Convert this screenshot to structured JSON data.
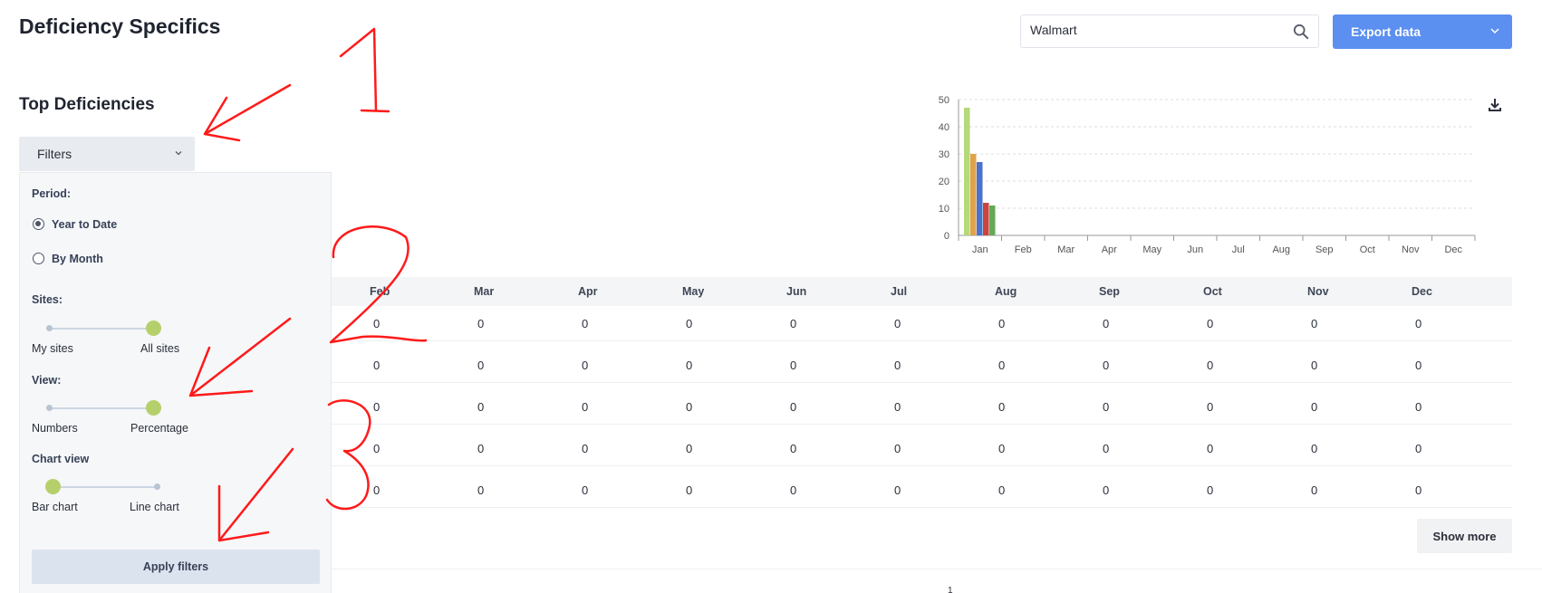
{
  "header": {
    "title": "Deficiency Specifics",
    "search_value": "Walmart",
    "export_label": "Export data"
  },
  "section": {
    "title": "Top Deficiencies",
    "filters_label": "Filters"
  },
  "filters": {
    "period_label": "Period:",
    "period_options": [
      "Year to Date",
      "By Month"
    ],
    "period_selected": "Year to Date",
    "sites_label": "Sites:",
    "sites_options": [
      "My sites",
      "All sites"
    ],
    "sites_selected": "All sites",
    "view_label": "View:",
    "view_options": [
      "Numbers",
      "Percentage"
    ],
    "view_selected": "Percentage",
    "chart_view_label": "Chart view",
    "chart_view_options": [
      "Bar chart",
      "Line chart"
    ],
    "chart_view_selected": "Bar chart",
    "apply_label": "Apply filters"
  },
  "chart_data": {
    "type": "bar",
    "categories": [
      "Jan",
      "Feb",
      "Mar",
      "Apr",
      "May",
      "Jun",
      "Jul",
      "Aug",
      "Sep",
      "Oct",
      "Nov",
      "Dec"
    ],
    "series": [
      {
        "color": "#b5d87a",
        "values": [
          47,
          0,
          0,
          0,
          0,
          0,
          0,
          0,
          0,
          0,
          0,
          0
        ]
      },
      {
        "color": "#e0a24a",
        "values": [
          30,
          0,
          0,
          0,
          0,
          0,
          0,
          0,
          0,
          0,
          0,
          0
        ]
      },
      {
        "color": "#4a72d0",
        "values": [
          27,
          0,
          0,
          0,
          0,
          0,
          0,
          0,
          0,
          0,
          0,
          0
        ]
      },
      {
        "color": "#c8453c",
        "values": [
          12,
          0,
          0,
          0,
          0,
          0,
          0,
          0,
          0,
          0,
          0,
          0
        ]
      },
      {
        "color": "#64a858",
        "values": [
          11,
          0,
          0,
          0,
          0,
          0,
          0,
          0,
          0,
          0,
          0,
          0
        ]
      }
    ],
    "yticks": [
      0,
      10,
      20,
      30,
      40,
      50
    ],
    "ylim": [
      0,
      50
    ],
    "grid": true,
    "title": "",
    "xlabel": "",
    "ylabel": ""
  },
  "table": {
    "columns": [
      "Feb",
      "Mar",
      "Apr",
      "May",
      "Jun",
      "Jul",
      "Aug",
      "Sep",
      "Oct",
      "Nov",
      "Dec"
    ],
    "rows": [
      [
        "0",
        "0",
        "0",
        "0",
        "0",
        "0",
        "0",
        "0",
        "0",
        "0",
        "0"
      ],
      [
        "0",
        "0",
        "0",
        "0",
        "0",
        "0",
        "0",
        "0",
        "0",
        "0",
        "0"
      ],
      [
        "0",
        "0",
        "0",
        "0",
        "0",
        "0",
        "0",
        "0",
        "0",
        "0",
        "0"
      ],
      [
        "0",
        "0",
        "0",
        "0",
        "0",
        "0",
        "0",
        "0",
        "0",
        "0",
        "0"
      ],
      [
        "0",
        "0",
        "0",
        "0",
        "0",
        "0",
        "0",
        "0",
        "0",
        "0",
        "0"
      ]
    ],
    "show_more_label": "Show more"
  },
  "footer": {
    "page_number": "1"
  },
  "annotations": {
    "marks": [
      "1",
      "2",
      "3"
    ],
    "color": "#ff1a1a"
  },
  "colors": {
    "accent": "#5b8ff0",
    "slider_knob": "#b5d06a"
  }
}
